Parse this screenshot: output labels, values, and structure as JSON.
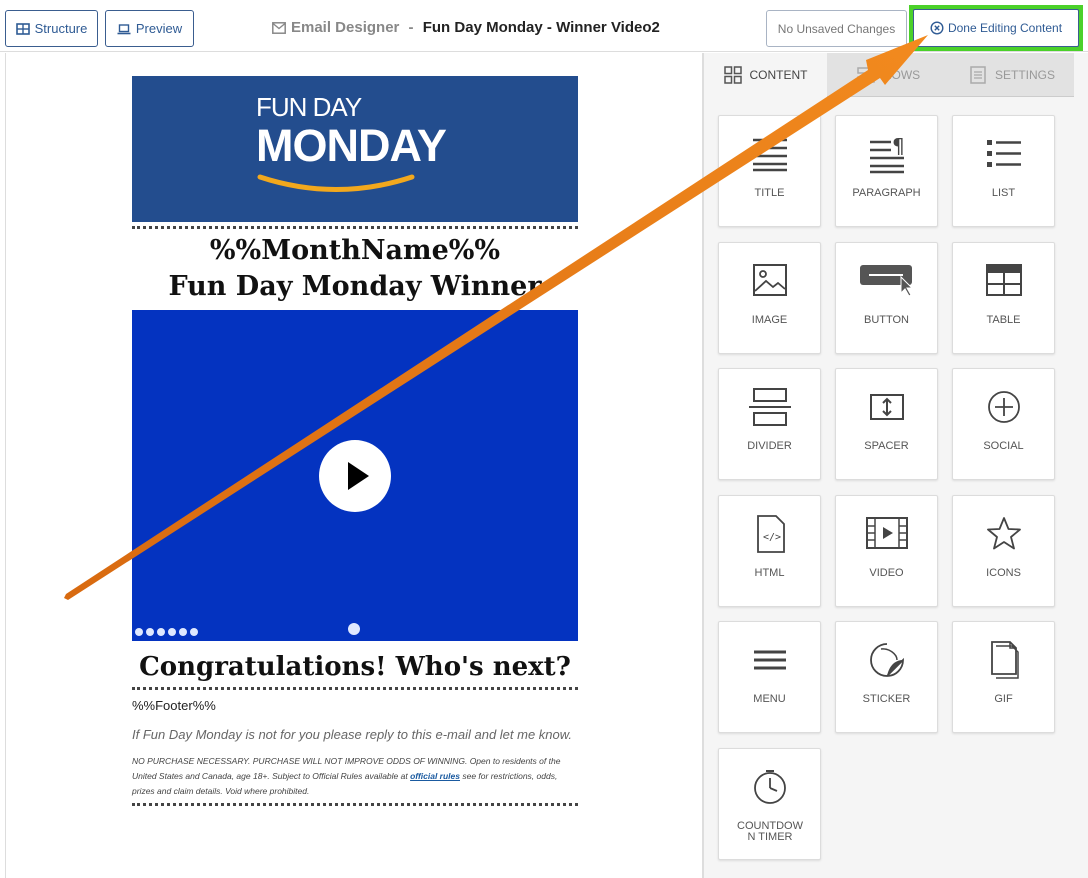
{
  "toolbar": {
    "structure_label": "Structure",
    "preview_label": "Preview",
    "title_prefix": "Email Designer",
    "title_separator": " - ",
    "title_name": "Fun Day Monday - Winner Video2",
    "unsaved_label": "No Unsaved Changes",
    "done_label": "Done Editing Content",
    "highlight_color": "#4bd12a"
  },
  "email": {
    "banner_line1": "FUN DAY",
    "banner_line2": "MONDAY",
    "heading_line1": "%%MonthName%%",
    "heading_line2": "Fun Day Monday Winner",
    "congrats": "Congratulations! Who's next?",
    "footer_var": "%%Footer%%",
    "optout": "If Fun Day Monday is not for you please reply to this e-mail and let me know.",
    "legal_1": "NO PURCHASE NECESSARY. PURCHASE WILL NOT IMPROVE ODDS OF WINNING. Open to residents of the United States and Canada, age 18+. Subject to Official Rules available at ",
    "legal_link": "official rules",
    "legal_2": " see for restrictions, odds, prizes and claim details. Void where prohibited."
  },
  "panel": {
    "tabs": [
      {
        "label": "CONTENT",
        "icon": "grid-icon"
      },
      {
        "label": "ROWS",
        "icon": "rows-icon"
      },
      {
        "label": "SETTINGS",
        "icon": "settings-icon"
      }
    ],
    "tiles": [
      {
        "label": "TITLE",
        "icon": "title-icon"
      },
      {
        "label": "PARAGRAPH",
        "icon": "paragraph-icon"
      },
      {
        "label": "LIST",
        "icon": "list-icon"
      },
      {
        "label": "IMAGE",
        "icon": "image-icon"
      },
      {
        "label": "BUTTON",
        "icon": "button-icon"
      },
      {
        "label": "TABLE",
        "icon": "table-icon"
      },
      {
        "label": "DIVIDER",
        "icon": "divider-icon"
      },
      {
        "label": "SPACER",
        "icon": "spacer-icon"
      },
      {
        "label": "SOCIAL",
        "icon": "social-icon"
      },
      {
        "label": "HTML",
        "icon": "html-icon"
      },
      {
        "label": "VIDEO",
        "icon": "video-icon"
      },
      {
        "label": "ICONS",
        "icon": "star-icon"
      },
      {
        "label": "MENU",
        "icon": "menu-icon"
      },
      {
        "label": "STICKER",
        "icon": "sticker-icon"
      },
      {
        "label": "GIF",
        "icon": "gif-icon"
      },
      {
        "label": "COUNTDOW N TIMER",
        "icon": "clock-icon"
      }
    ]
  }
}
